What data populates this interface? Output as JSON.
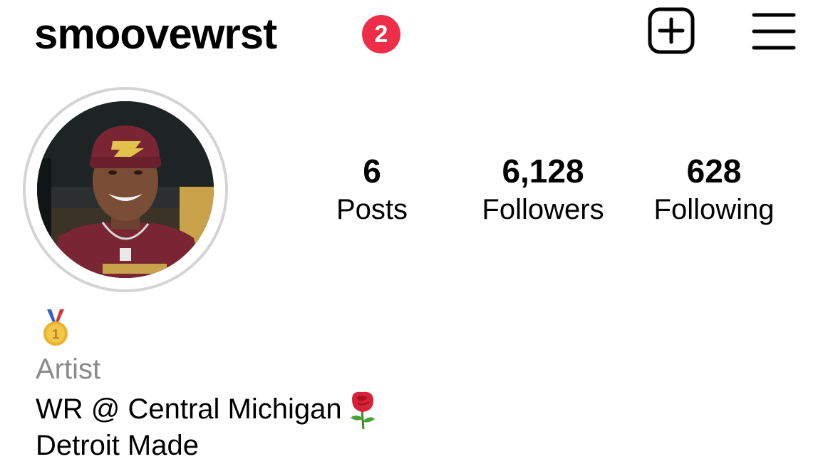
{
  "header": {
    "username": "smoovewrst",
    "notification_count": "2",
    "new_post_icon": "plus-square-icon",
    "menu_icon": "hamburger-menu-icon"
  },
  "profile": {
    "avatar": "profile-photo"
  },
  "stats": [
    {
      "value": "6",
      "label": "Posts"
    },
    {
      "value": "6,128",
      "label": "Followers"
    },
    {
      "value": "628",
      "label": "Following"
    }
  ],
  "bio": {
    "medal_icon": "gold-medal-icon",
    "category": "Artist",
    "line1": "WR @ Central Michigan",
    "line1_emoji": "rose-icon",
    "line2": "Detroit Made"
  },
  "colors": {
    "badge": "#ee2e48",
    "category_text": "#8a8a8a",
    "avatar_ring": "#d4d4d4"
  }
}
